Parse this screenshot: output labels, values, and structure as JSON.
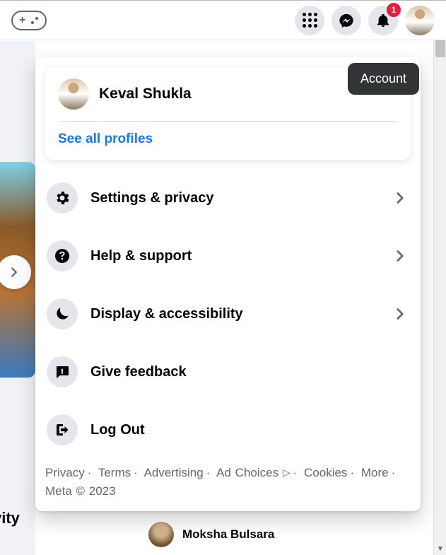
{
  "topbar": {
    "notifications_badge": "1"
  },
  "tooltip": {
    "text": "Account"
  },
  "profile": {
    "name": "Keval Shukla",
    "see_all": "See all profiles"
  },
  "menu": {
    "settings": "Settings & privacy",
    "help": "Help & support",
    "display": "Display & accessibility",
    "feedback": "Give feedback",
    "logout": "Log Out"
  },
  "footer": {
    "privacy": "Privacy",
    "terms": "Terms",
    "advertising": "Advertising",
    "adchoices": "Ad Choices",
    "cookies": "Cookies",
    "more": "More",
    "meta": "Meta © 2023"
  },
  "background": {
    "vity": "vity",
    "contact": "Moksha Bulsara"
  }
}
